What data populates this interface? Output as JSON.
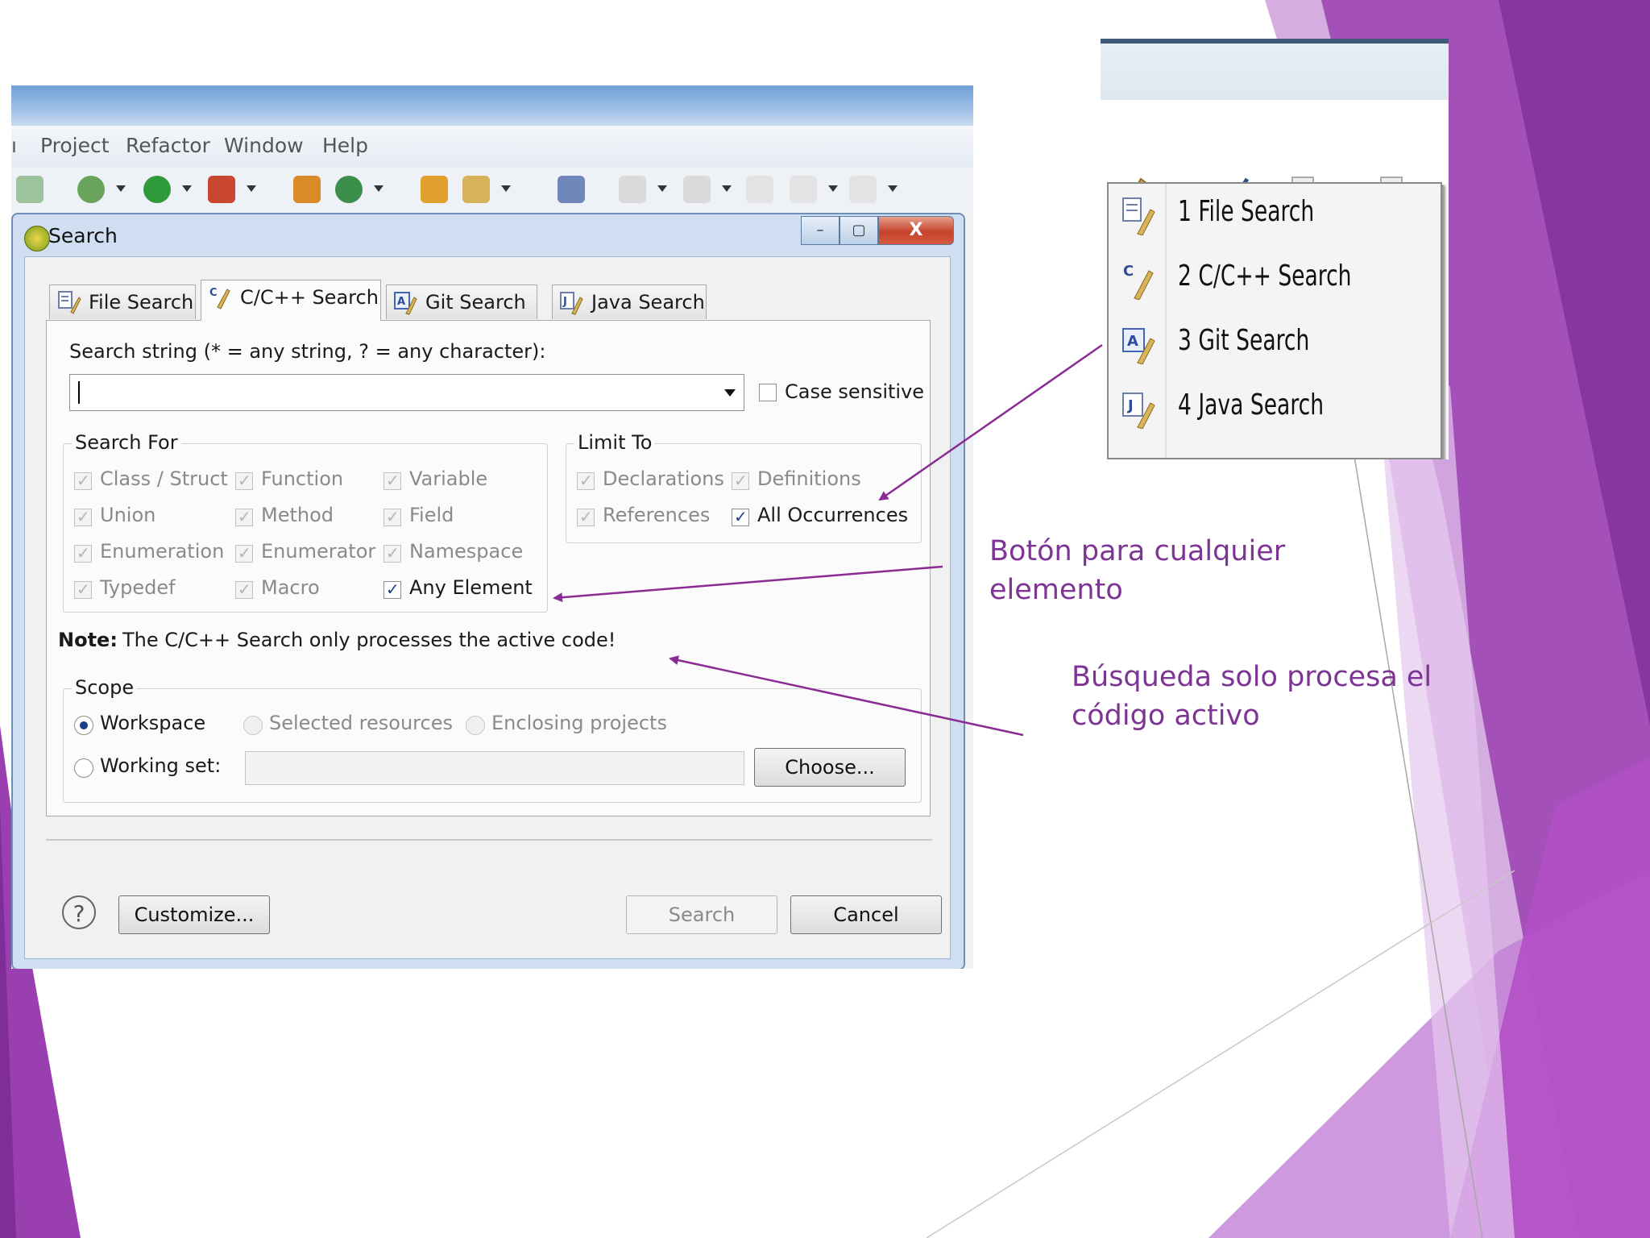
{
  "colors": {
    "accent_purple": "#9a3fb0",
    "annotation_text": "#7d3495",
    "arrow": "#8a2b94"
  },
  "eclipse": {
    "menu": [
      "Project",
      "Refactor",
      "Window",
      "Help"
    ]
  },
  "dialog": {
    "title": "Search",
    "close_glyph": "X",
    "tabs": [
      {
        "label": "File Search",
        "icon": "file-search-icon"
      },
      {
        "label": "C/C++ Search",
        "icon": "cpp-search-icon",
        "active": true
      },
      {
        "label": "Git Search",
        "icon": "git-search-icon"
      },
      {
        "label": "Java Search",
        "icon": "java-search-icon"
      }
    ],
    "search_string_label": "Search string (* = any string, ? = any character):",
    "search_string_value": "",
    "case_sensitive_label": "Case sensitive",
    "search_for": {
      "title": "Search For",
      "options": [
        "Class / Struct",
        "Function",
        "Variable",
        "Union",
        "Method",
        "Field",
        "Enumeration",
        "Enumerator",
        "Namespace",
        "Typedef",
        "Macro",
        "Any Element"
      ]
    },
    "limit_to": {
      "title": "Limit To",
      "options": [
        "Declarations",
        "Definitions",
        "References",
        "All Occurrences"
      ]
    },
    "note_bold": "Note:",
    "note_text": "The C/C++ Search only processes the active code!",
    "scope": {
      "title": "Scope",
      "workspace": "Workspace",
      "selected_resources": "Selected resources",
      "enclosing_projects": "Enclosing projects",
      "working_set": "Working set:",
      "choose": "Choose..."
    },
    "buttons": {
      "help": "?",
      "customize": "Customize...",
      "search": "Search",
      "cancel": "Cancel"
    }
  },
  "popup_menu": {
    "items": [
      "1 File Search",
      "2 C/C++ Search",
      "3 Git Search",
      "4 Java Search"
    ]
  },
  "annotations": {
    "any_element": "Botón para cualquier elemento",
    "active_code": "Búsqueda solo procesa el código activo"
  }
}
